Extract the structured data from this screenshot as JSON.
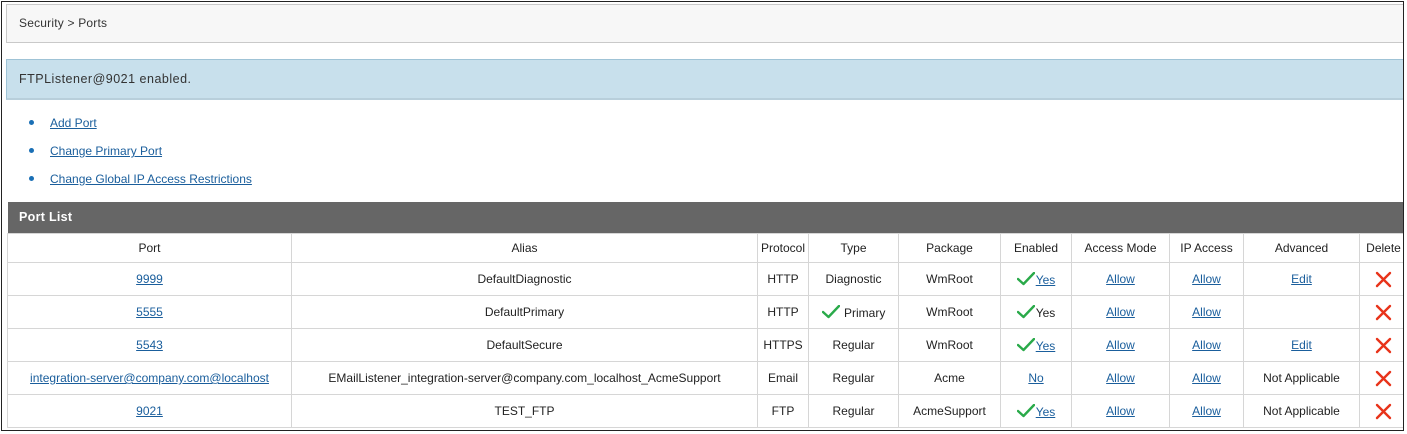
{
  "breadcrumb": "Security > Ports",
  "message": "FTPListener@9021 enabled.",
  "links": [
    {
      "label": "Add Port"
    },
    {
      "label": "Change Primary Port"
    },
    {
      "label": "Change Global IP Access Restrictions"
    }
  ],
  "section_title": "Port List",
  "columns": [
    "Port",
    "Alias",
    "Protocol",
    "Type",
    "Package",
    "Enabled",
    "Access Mode",
    "IP Access",
    "Advanced",
    "Delete"
  ],
  "rows": [
    {
      "port": "9999",
      "alias": "DefaultDiagnostic",
      "protocol": "HTTP",
      "type": "Diagnostic",
      "type_icon": "",
      "package": "WmRoot",
      "enabled": "Yes",
      "enabled_icon": "check-icon",
      "enabled_link": true,
      "access_mode": "Allow",
      "ip_access": "Allow",
      "advanced": "Edit",
      "advanced_link": true
    },
    {
      "port": "5555",
      "alias": "DefaultPrimary",
      "protocol": "HTTP",
      "type": "Primary",
      "type_icon": "check-icon",
      "package": "WmRoot",
      "enabled": "Yes",
      "enabled_icon": "check-icon",
      "enabled_link": false,
      "access_mode": "Allow",
      "ip_access": "Allow",
      "advanced": "",
      "advanced_link": false
    },
    {
      "port": "5543",
      "alias": "DefaultSecure",
      "protocol": "HTTPS",
      "type": "Regular",
      "type_icon": "",
      "package": "WmRoot",
      "enabled": "Yes",
      "enabled_icon": "check-icon",
      "enabled_link": true,
      "access_mode": "Allow",
      "ip_access": "Allow",
      "advanced": "Edit",
      "advanced_link": true
    },
    {
      "port": "integration-server@company.com@localhost",
      "alias": "EMailListener_integration-server@company.com_localhost_AcmeSupport",
      "protocol": "Email",
      "type": "Regular",
      "type_icon": "",
      "package": "Acme",
      "enabled": "No",
      "enabled_icon": "",
      "enabled_link": true,
      "access_mode": "Allow",
      "ip_access": "Allow",
      "advanced": "Not Applicable",
      "advanced_link": false
    },
    {
      "port": "9021",
      "alias": "TEST_FTP",
      "protocol": "FTP",
      "type": "Regular",
      "type_icon": "",
      "package": "AcmeSupport",
      "enabled": "Yes",
      "enabled_icon": "check-icon",
      "enabled_link": true,
      "access_mode": "Allow",
      "ip_access": "Allow",
      "advanced": "Not Applicable",
      "advanced_link": false
    }
  ],
  "colors": {
    "check": "#2aaa4a",
    "delete": "#e8331a",
    "link": "#1a5e9c",
    "header_bar": "#666666",
    "message_bg": "#c8e0ec"
  }
}
